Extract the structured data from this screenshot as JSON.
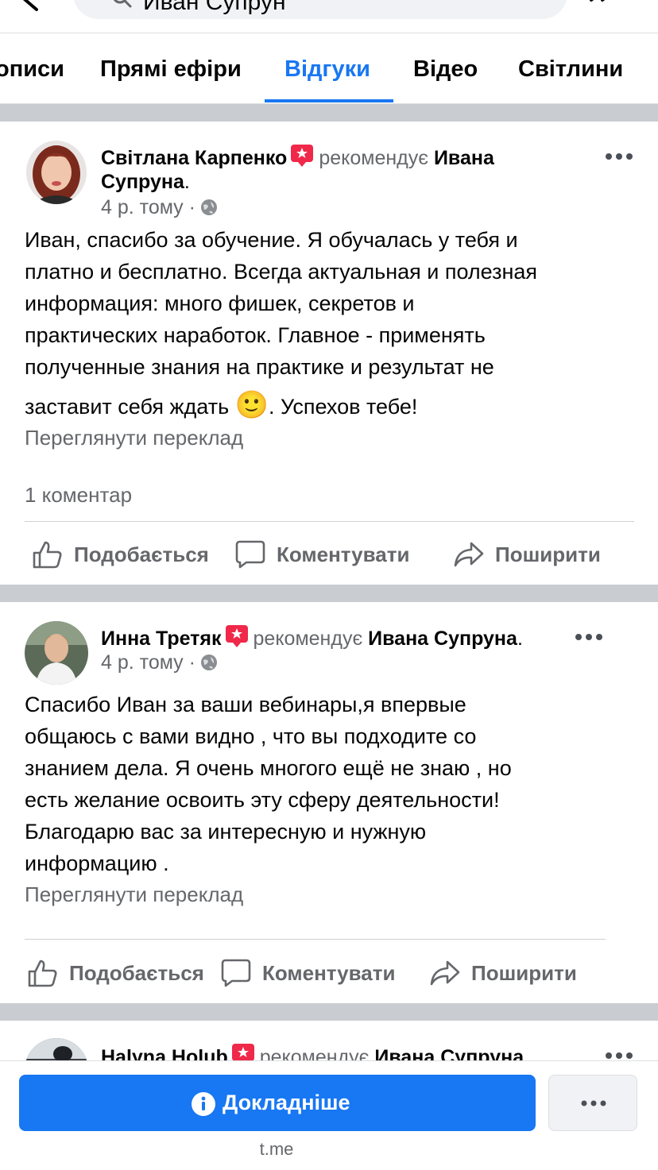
{
  "search": {
    "query": "Иван Супрун"
  },
  "tabs": [
    {
      "label": "описи"
    },
    {
      "label": "Прямі ефіри"
    },
    {
      "label": "Відгуки",
      "active": true
    },
    {
      "label": "Відео"
    },
    {
      "label": "Світлини"
    }
  ],
  "colors": {
    "accent": "#1877f2",
    "badge": "#f02849",
    "muted": "#65676b"
  },
  "reviews": [
    {
      "author": "Світлана Карпенко",
      "verb": "рекомендує",
      "target_line1": "Ивана",
      "target_line2": "Супруна",
      "punct": ".",
      "time": "4 р. тому",
      "dot": "·",
      "text_lines": [
        "Иван, спасибо за обучение. Я обучалась у тебя и",
        "платно и бесплатно. Всегда актуальная и полезная",
        "информация: много фишек, секретов и",
        "практических наработок. Главное - применять",
        "полученные знания на практике и результат не"
      ],
      "text_last_before": "заставит себя ждать",
      "emoji": "🙂",
      "text_last_after": ". Успехов тебе!",
      "translate": "Переглянути переклад",
      "comments": "1 коментар",
      "actions": {
        "like": "Подобається",
        "comment": "Коментувати",
        "share": "Поширити"
      }
    },
    {
      "author": "Инна Третяк",
      "verb": "рекомендує",
      "target": "Ивана Супруна",
      "punct": ".",
      "time": "4 р. тому",
      "dot": "·",
      "text_lines": [
        "Спасибо Иван за ваши вебинары,я впервые",
        "общаюсь с вами видно , что вы подходите со",
        "знанием дела. Я очень многого ещё не знаю , но",
        "есть желание освоить эту сферу деятельности!",
        "Благодарю вас за интересную и нужную",
        "информацию ."
      ],
      "translate": "Переглянути переклад",
      "actions": {
        "like": "Подобається",
        "comment": "Коментувати",
        "share": "Поширити"
      }
    },
    {
      "author": "Halyna Holub",
      "verb": "рекомендує",
      "target": "Ивана Супруна",
      "punct": "."
    }
  ],
  "bottom": {
    "button_label": "Докладніше",
    "domain": "t.me"
  }
}
